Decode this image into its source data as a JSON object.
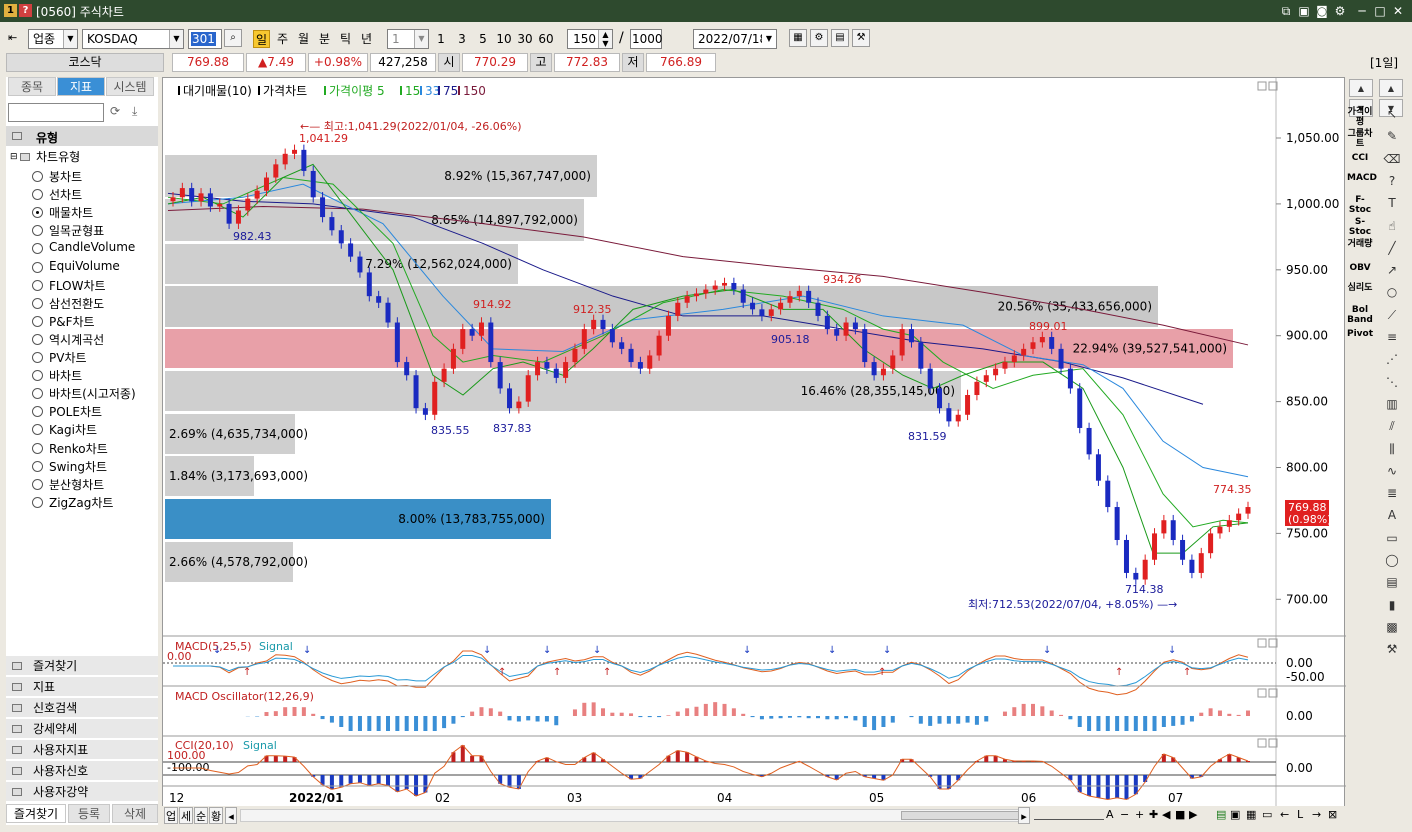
{
  "window": {
    "number_badges": [
      "1",
      "?"
    ],
    "title": "[0560] 주식차트"
  },
  "toolbar": {
    "market_type": "업종",
    "market": "KOSDAQ",
    "code": "301",
    "periods": [
      "일",
      "주",
      "월",
      "분",
      "틱",
      "년"
    ],
    "selected_period": "일",
    "interval": "1",
    "intervals": [
      "1",
      "3",
      "5",
      "10",
      "30",
      "60"
    ],
    "count": "150",
    "slash": "/",
    "max_count": "1000",
    "date": "2022/07/18"
  },
  "quote": {
    "name": "코스닥",
    "price": "769.88",
    "change": "▲7.49",
    "change_pct": "+0.98%",
    "volume": "427,258",
    "open_label": "시",
    "open": "770.29",
    "high_label": "고",
    "high": "772.83",
    "low_label": "저",
    "low": "766.89",
    "period_badge": "[1일]"
  },
  "sidebar": {
    "tabs": [
      "종목",
      "지표",
      "시스템"
    ],
    "selected_tab": "지표",
    "section_title": "유형",
    "tree_root": "차트유형",
    "chart_types": [
      "봉차트",
      "선차트",
      "매물차트",
      "일목균형표",
      "CandleVolume",
      "EquiVolume",
      "FLOW차트",
      "삼선전환도",
      "P&F차트",
      "역시계곡선",
      "PV차트",
      "바차트",
      "바차트(시고저종)",
      "POLE차트",
      "Kagi차트",
      "Renko차트",
      "Swing차트",
      "분산형차트",
      "ZigZag차트"
    ],
    "selected_type": "매물차트",
    "groups": [
      "즐겨찾기",
      "지표",
      "신호검색",
      "강세약세",
      "사용자지표",
      "사용자신호",
      "사용자강약"
    ],
    "bottom_tabs": [
      "즐겨찾기",
      "등록",
      "삭제"
    ]
  },
  "chart": {
    "legend": [
      {
        "text": "대기매물(10)",
        "color": "#000000"
      },
      {
        "text": "가격차트",
        "color": "#000000"
      },
      {
        "text": "가격이평 5",
        "color": "#22aa22"
      },
      {
        "text": "15",
        "color": "#22aa22"
      },
      {
        "text": "33",
        "color": "#2a88dd"
      },
      {
        "text": "75",
        "color": "#1a1a8a"
      },
      {
        "text": "150",
        "color": "#7a1a3a"
      }
    ],
    "high_annotation": "최고:1,041.29(2022/01/04, -26.06%)",
    "low_annotation": "최저:712.53(2022/07/04, +8.05%)",
    "current_price_box": [
      "769.88",
      "(0.98%)"
    ],
    "y_ticks": [
      "1,050.00",
      "1,000.00",
      "950.00",
      "900.00",
      "850.00",
      "800.00",
      "750.00",
      "700.00"
    ],
    "x_ticks": [
      "12",
      "2022/01",
      "02",
      "03",
      "04",
      "05",
      "06",
      "07"
    ],
    "point_labels": [
      {
        "text": "1,041.29",
        "color": "#d02020"
      },
      {
        "text": "982.43",
        "color": "#1a1a9a"
      },
      {
        "text": "914.92",
        "color": "#d02020"
      },
      {
        "text": "912.35",
        "color": "#d02020"
      },
      {
        "text": "934.26",
        "color": "#d02020"
      },
      {
        "text": "905.18",
        "color": "#1a1a9a"
      },
      {
        "text": "899.01",
        "color": "#d02020"
      },
      {
        "text": "835.55",
        "color": "#1a1a9a"
      },
      {
        "text": "837.83",
        "color": "#1a1a9a"
      },
      {
        "text": "831.59",
        "color": "#1a1a9a"
      },
      {
        "text": "774.35",
        "color": "#d02020"
      },
      {
        "text": "714.38",
        "color": "#1a1a9a"
      }
    ],
    "volume_profile": [
      {
        "label": "8.92% (15,367,747,000)",
        "pct": 8.92
      },
      {
        "label": "8.65% (14,897,792,000)",
        "pct": 8.65
      },
      {
        "label": "7.29% (12,562,024,000)",
        "pct": 7.29
      },
      {
        "label": "20.56% (35,433,656,000)",
        "pct": 20.56
      },
      {
        "label": "22.94% (39,527,541,000)",
        "pct": 22.94
      },
      {
        "label": "16.46% (28,355,145,000)",
        "pct": 16.46
      },
      {
        "label": "2.69% (4,635,734,000)",
        "pct": 2.69
      },
      {
        "label": "1.84% (3,173,693,000)",
        "pct": 1.84
      },
      {
        "label": "8.00% (13,783,755,000)",
        "pct": 8.0
      },
      {
        "label": "2.66% (4,578,792,000)",
        "pct": 2.66
      }
    ],
    "macd": {
      "title": "MACD(5,25,5)",
      "signal": "Signal",
      "left_value": "0.00",
      "ticks": [
        "0.00",
        "-50.00"
      ]
    },
    "macd_osc": {
      "title": "MACD Oscillator(12,26,9)",
      "ticks": [
        "0.00"
      ]
    },
    "cci": {
      "title": "CCI(20,10)",
      "signal": "Signal",
      "upper": "100.00",
      "lower": "-100.00",
      "ticks": [
        "0.00"
      ]
    }
  },
  "chart_data": {
    "type": "candlestick",
    "title": "",
    "x": [
      "2021/12",
      "2022/01",
      "2022/02",
      "2022/03",
      "2022/04",
      "2022/05",
      "2022/06",
      "2022/07"
    ],
    "ylim": [
      680,
      1070
    ],
    "extremes": {
      "high": 1041.29,
      "low": 712.53
    },
    "notable_points": [
      1041.29,
      982.43,
      914.92,
      912.35,
      934.26,
      905.18,
      899.01,
      835.55,
      837.83,
      831.59,
      774.35,
      714.38
    ],
    "last_close": 769.88
  },
  "bottom": {
    "buttons": [
      "업",
      "세",
      "순",
      "황"
    ]
  },
  "right_tools": [
    "가격이평",
    "그룹차트",
    "CCI",
    "MACD",
    "F-Stoc",
    "S-Stoc",
    "거래량",
    "OBV",
    "심리도",
    "Bol Band",
    "Pivot"
  ]
}
